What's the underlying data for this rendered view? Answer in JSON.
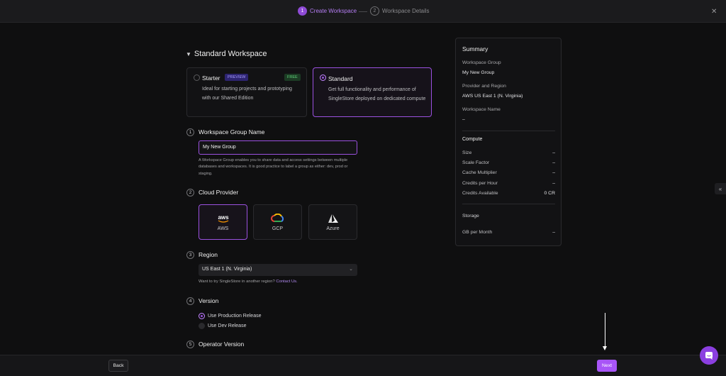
{
  "stepper": {
    "step1_num": "1",
    "step1_label": "Create Workspace",
    "step2_num": "2",
    "step2_label": "Workspace Details"
  },
  "heading": "Standard Workspace",
  "editions": {
    "starter": {
      "title": "Starter",
      "badge": "PREVIEW",
      "price_badge": "FREE",
      "desc": "Ideal for starting projects and prototyping with our Shared Edition"
    },
    "standard": {
      "title": "Standard",
      "desc": "Get full functionality and performance of SingleStore deployed on dedicated compute"
    }
  },
  "sections": {
    "group_name": {
      "num": "1",
      "title": "Workspace Group Name",
      "value": "My New Group",
      "help": "A Workspace Group enables you to share data and access settings between multiple databases and workspaces. It is good practice to label a group as either: dev, prod or staging."
    },
    "provider": {
      "num": "2",
      "title": "Cloud Provider",
      "options": [
        "AWS",
        "GCP",
        "Azure"
      ],
      "selected": "AWS"
    },
    "region": {
      "num": "3",
      "title": "Region",
      "value": "US East 1 (N. Virginia)",
      "note": "Want to try SingleStore in another region?",
      "link": "Contact Us."
    },
    "version": {
      "num": "4",
      "title": "Version",
      "options": [
        "Use Production Release",
        "Use Dev Release"
      ]
    },
    "operator": {
      "num": "5",
      "title": "Operator Version"
    }
  },
  "summary": {
    "title": "Summary",
    "group_label": "Workspace Group",
    "group_value": "My New Group",
    "provider_label": "Provider and Region",
    "provider_value": "AWS US East 1 (N. Virginia)",
    "wsname_label": "Workspace Name",
    "wsname_value": "–",
    "compute_title": "Compute",
    "compute_rows": [
      {
        "label": "Size",
        "value": "–"
      },
      {
        "label": "Scale Factor",
        "value": "–"
      },
      {
        "label": "Cache Multiplier",
        "value": "–"
      },
      {
        "label": "Credits per Hour",
        "value": "–"
      },
      {
        "label": "Credits Available",
        "value": "0 CR"
      }
    ],
    "storage_title": "Storage",
    "storage_rows": [
      {
        "label": "GB per Month",
        "value": "–"
      }
    ]
  },
  "footer": {
    "back": "Back",
    "next": "Next"
  },
  "colors": {
    "accent": "#9b51e0",
    "button": "#a855f7"
  }
}
